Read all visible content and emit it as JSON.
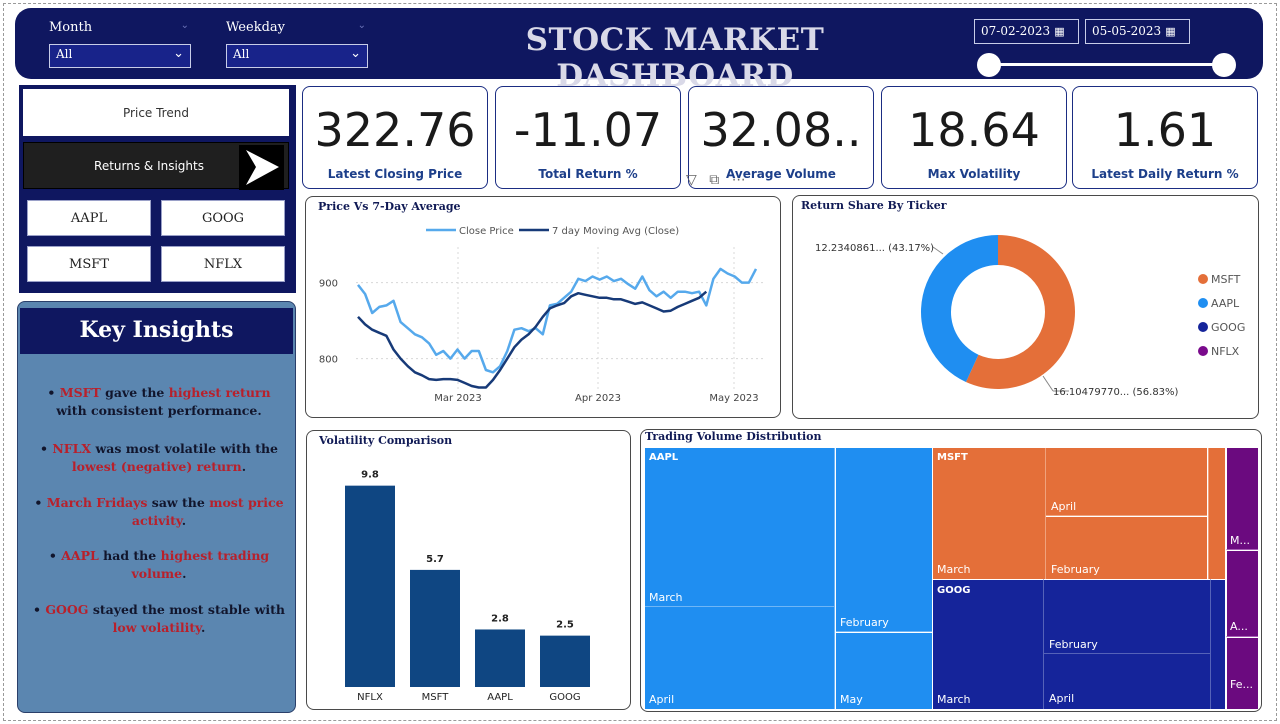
{
  "header": {
    "title": "STOCK MARKET DASHBOARD",
    "month": {
      "label": "Month",
      "value": "All"
    },
    "weekday": {
      "label": "Weekday",
      "value": "All"
    },
    "date_start": "07-02-2023",
    "date_end": "05-05-2023"
  },
  "nav": {
    "price_trend": "Price Trend",
    "returns_insights": "Returns & Insights",
    "tickers": [
      "AAPL",
      "GOOG",
      "MSFT",
      "NFLX"
    ]
  },
  "insights": {
    "title": "Key Insights",
    "items": [
      {
        "parts": [
          {
            "t": "• ",
            "h": false
          },
          {
            "t": "MSFT",
            "h": true
          },
          {
            "t": " gave the ",
            "h": false
          },
          {
            "t": "highest return",
            "h": true
          },
          {
            "t": " with consistent performance.",
            "h": false
          }
        ]
      },
      {
        "parts": [
          {
            "t": "• ",
            "h": false
          },
          {
            "t": "NFLX",
            "h": true
          },
          {
            "t": " was most volatile with the ",
            "h": false
          },
          {
            "t": "lowest (negative) return",
            "h": true
          },
          {
            "t": ".",
            "h": false
          }
        ]
      },
      {
        "parts": [
          {
            "t": "• ",
            "h": false
          },
          {
            "t": "March Fridays",
            "h": true
          },
          {
            "t": " saw the ",
            "h": false
          },
          {
            "t": "most price activity",
            "h": true
          },
          {
            "t": ".",
            "h": false
          }
        ]
      },
      {
        "parts": [
          {
            "t": "• ",
            "h": false
          },
          {
            "t": "AAPL",
            "h": true
          },
          {
            "t": "  had the ",
            "h": false
          },
          {
            "t": "highest trading volume",
            "h": true
          },
          {
            "t": ".",
            "h": false
          }
        ]
      },
      {
        "parts": [
          {
            "t": "• ",
            "h": false
          },
          {
            "t": "GOOG",
            "h": true
          },
          {
            "t": " stayed the most stable with ",
            "h": false
          },
          {
            "t": "low volatility",
            "h": true
          },
          {
            "t": ".",
            "h": false
          }
        ]
      }
    ]
  },
  "kpis": [
    {
      "value": "322.76",
      "label": "Latest Closing Price"
    },
    {
      "value": "-11.07",
      "label": "Total Return %"
    },
    {
      "value": "32.08..",
      "label": "Average Volume"
    },
    {
      "value": "18.64",
      "label": "Max Volatility"
    },
    {
      "value": "1.61",
      "label": "Latest Daily Return %"
    }
  ],
  "chart_data": [
    {
      "type": "line",
      "title": "Price Vs 7-Day Average",
      "x_ticks": [
        "Mar 2023",
        "Apr 2023",
        "May 2023"
      ],
      "y_ticks": [
        800,
        900
      ],
      "ylim": [
        760,
        960
      ],
      "legend_position": "top",
      "series": [
        {
          "name": "Close Price",
          "color": "#56a9ec",
          "values": [
            897,
            885,
            860,
            868,
            870,
            876,
            848,
            840,
            832,
            828,
            820,
            805,
            810,
            800,
            812,
            800,
            810,
            810,
            785,
            782,
            790,
            810,
            838,
            840,
            836,
            840,
            832,
            870,
            872,
            880,
            888,
            905,
            902,
            908,
            904,
            908,
            902,
            905,
            898,
            892,
            908,
            890,
            882,
            888,
            880,
            888,
            888,
            886,
            888,
            870,
            905,
            918,
            912,
            908,
            900,
            900,
            918
          ]
        },
        {
          "name": "7 day Moving Avg (Close)",
          "color": "#173a78",
          "values": [
            855,
            845,
            838,
            834,
            830,
            812,
            800,
            790,
            782,
            778,
            773,
            772,
            773,
            773,
            772,
            768,
            764,
            762,
            762,
            772,
            785,
            800,
            815,
            825,
            832,
            842,
            855,
            866,
            870,
            873,
            882,
            886,
            884,
            882,
            880,
            880,
            878,
            878,
            875,
            872,
            874,
            870,
            866,
            862,
            863,
            868,
            872,
            876,
            880,
            888
          ]
        }
      ]
    },
    {
      "type": "pie",
      "title": "Return Share By Ticker",
      "legend_position": "right",
      "legend": [
        {
          "name": "MSFT",
          "color": "#e46f39"
        },
        {
          "name": "AAPL",
          "color": "#1f8ef1"
        },
        {
          "name": "GOOG",
          "color": "#15249a"
        },
        {
          "name": "NFLX",
          "color": "#7a0a8c"
        }
      ],
      "slices": [
        {
          "name": "MSFT",
          "value": 56.83,
          "label": "16.10479770... (56.83%)",
          "color": "#e46f39"
        },
        {
          "name": "AAPL",
          "value": 43.17,
          "label": "12.2340861... (43.17%)",
          "color": "#1f8ef1"
        }
      ]
    },
    {
      "type": "bar",
      "title": "Volatility Comparison",
      "categories": [
        "NFLX",
        "MSFT",
        "AAPL",
        "GOOG"
      ],
      "values": [
        9.8,
        5.7,
        2.8,
        2.5
      ],
      "labels": [
        "9.8",
        "5.7",
        "2.8",
        "2.5"
      ],
      "ylim": [
        0,
        11
      ],
      "color": "#0f4682"
    }
  ],
  "treemap": {
    "title": "Trading Volume Distribution",
    "groups": [
      {
        "name": "AAPL",
        "color": "#1f8ef1",
        "cells": [
          "March",
          "April",
          "February",
          "May"
        ]
      },
      {
        "name": "MSFT",
        "color": "#e46f39",
        "cells": [
          "March",
          "April",
          "February"
        ]
      },
      {
        "name": "GOOG",
        "color": "#15249a",
        "cells": [
          "March",
          "February",
          "April"
        ]
      },
      {
        "name": "NFLX",
        "color": "#6b0a7f",
        "cells": [
          "M...",
          "A...",
          "Fe..."
        ]
      }
    ]
  }
}
